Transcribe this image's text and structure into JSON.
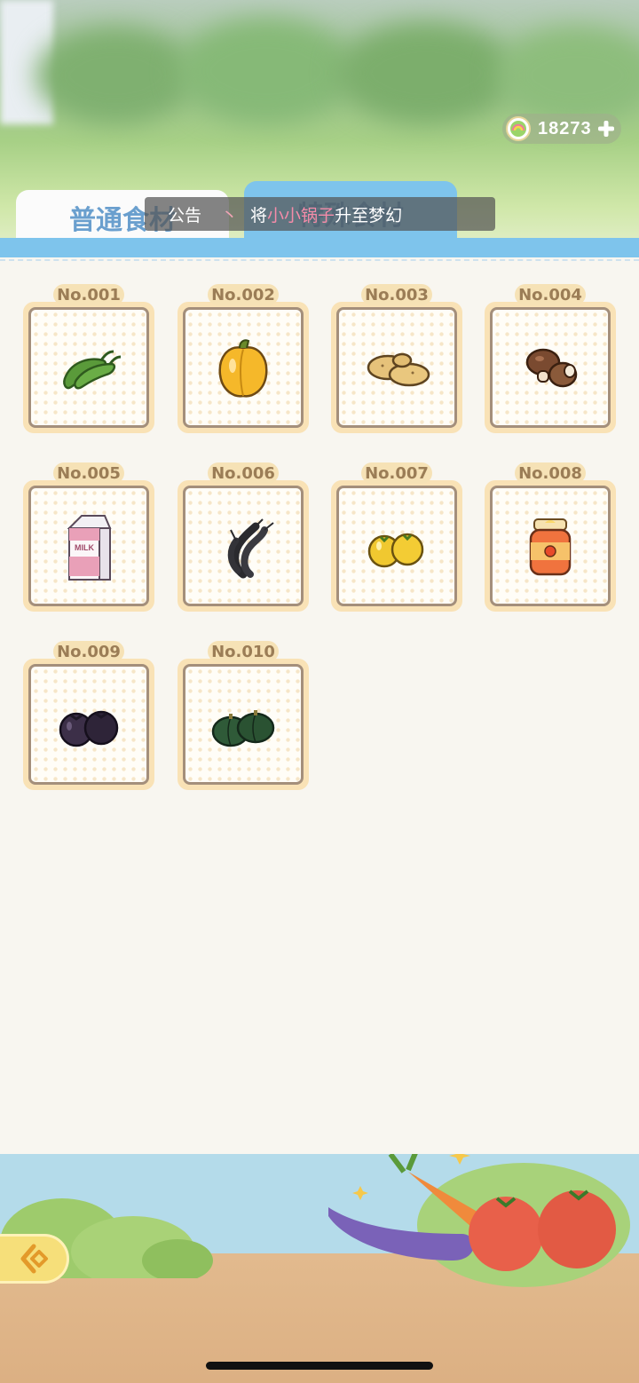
{
  "currency": {
    "amount": "18273",
    "icon": "rainbow-coin-icon",
    "add_icon": "plus-icon"
  },
  "tabs": [
    {
      "label": "普通食材",
      "active": false
    },
    {
      "label": "特殊食材",
      "active": true
    }
  ],
  "notice": {
    "label": "公告",
    "separator": "丶",
    "prefix": "将",
    "highlight": "小小锅子",
    "suffix": "升至梦幻"
  },
  "items": [
    {
      "no": "No.001",
      "icon": "green-pepper-icon"
    },
    {
      "no": "No.002",
      "icon": "yellow-bell-pepper-icon"
    },
    {
      "no": "No.003",
      "icon": "potato-icon"
    },
    {
      "no": "No.004",
      "icon": "mushroom-icon"
    },
    {
      "no": "No.005",
      "icon": "milk-carton-icon"
    },
    {
      "no": "No.006",
      "icon": "shrimp-icon"
    },
    {
      "no": "No.007",
      "icon": "yellow-tomato-icon"
    },
    {
      "no": "No.008",
      "icon": "jam-jar-icon"
    },
    {
      "no": "No.009",
      "icon": "eggplant-icon"
    },
    {
      "no": "No.010",
      "icon": "pumpkin-icon"
    }
  ],
  "milk_label": "MILK",
  "back_button": {
    "icon": "back-arrow-icon"
  },
  "colors": {
    "tab_active": "#7ec4ec",
    "tab_inactive": "#fbfbfb",
    "notice_highlight": "#f58ca9",
    "item_frame": "#f9e2b6"
  }
}
